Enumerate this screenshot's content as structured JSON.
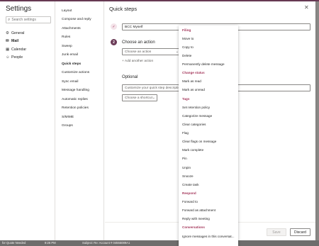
{
  "settings": {
    "title": "Settings",
    "search_placeholder": "Search settings",
    "nav": [
      {
        "label": "General",
        "icon": "gear-icon",
        "glyph": "⚙"
      },
      {
        "label": "Mail",
        "icon": "mail-icon",
        "glyph": "✉"
      },
      {
        "label": "Calendar",
        "icon": "calendar-icon",
        "glyph": "▦"
      },
      {
        "label": "People",
        "icon": "people-icon",
        "glyph": "☺"
      }
    ]
  },
  "mail_sections": [
    "Layout",
    "Compose and reply",
    "Attachments",
    "Rules",
    "Sweep",
    "Junk email",
    "Quick steps",
    "Customize actions",
    "Sync email",
    "Message handling",
    "Automatic replies",
    "Retention policies",
    "S/MIME",
    "Groups"
  ],
  "quick_steps": {
    "title": "Quick steps",
    "step1_icon": "checkmark-icon",
    "name_value": "BCC Myself",
    "step2_number": "2",
    "choose_label": "Choose an action",
    "choose_placeholder": "Choose an action",
    "add_action": "+ Add another action",
    "optional_label": "Optional",
    "description_placeholder": "Customize your quick step description",
    "shortcut_placeholder": "Choose a shortcut",
    "save": "Save",
    "discard": "Discard"
  },
  "action_dropdown": [
    {
      "label": "Filing",
      "header": true
    },
    {
      "label": "Move to"
    },
    {
      "label": "Copy to"
    },
    {
      "label": "Delete"
    },
    {
      "label": "Permanently delete message"
    },
    {
      "label": "Change status",
      "header": true
    },
    {
      "label": "Mark as read"
    },
    {
      "label": "Mark as unread"
    },
    {
      "label": "Tags",
      "header": true
    },
    {
      "label": "Set retention policy"
    },
    {
      "label": "Categorize message"
    },
    {
      "label": "Clear categories"
    },
    {
      "label": "Flag"
    },
    {
      "label": "Clear flags on message"
    },
    {
      "label": "Mark complete"
    },
    {
      "label": "Pin"
    },
    {
      "label": "Unpin"
    },
    {
      "label": "Snooze"
    },
    {
      "label": "Create task"
    },
    {
      "label": "Respond",
      "header": true
    },
    {
      "label": "Forward to"
    },
    {
      "label": "Forward as attachment"
    },
    {
      "label": "Reply with meeting"
    },
    {
      "label": "Conversations",
      "header": true
    },
    {
      "label": "Ignore messages in this conversat..."
    }
  ],
  "statusbar": {
    "left": "for Quote Needed",
    "time": "9:26 PM",
    "subject": "Subject: Re: Account # 04555089A1"
  },
  "colors": {
    "accent": "#6b3b57",
    "header": "#a4375b"
  }
}
